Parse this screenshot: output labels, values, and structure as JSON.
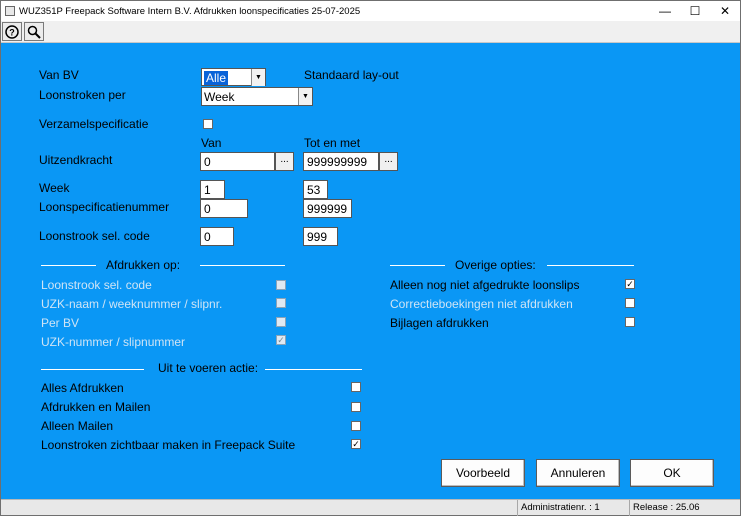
{
  "titlebar": {
    "title": "WUZ351P    Freepack Software Intern B.V.  Afdrukken loonspecificaties  25-07-2025",
    "minimize": "—",
    "maximize": "☐",
    "close": "✕"
  },
  "toolbar": {
    "help_icon": "help-icon",
    "search_icon": "search-icon"
  },
  "form": {
    "van_bv_label": "Van BV",
    "van_bv_value": "Alle",
    "standaard_layout": "Standaard lay-out",
    "loonstroken_per_label": "Loonstroken per",
    "loonstroken_per_value": "Week",
    "verzamelspec_label": "Verzamelspecificatie",
    "van_header": "Van",
    "tot_header": "Tot en met",
    "uitzendkracht_label": "Uitzendkracht",
    "uitzendkracht_van": "0",
    "uitzendkracht_tot": "999999999",
    "dots": "...",
    "week_label": "Week",
    "week_van": "1",
    "week_tot": "53",
    "loonspec_label": "Loonspecificatienummer",
    "loonspec_van": "0",
    "loonspec_tot": "999999",
    "selcode_label": "Loonstrook sel. code",
    "selcode_van": "0",
    "selcode_tot": "999"
  },
  "afdrukken_op": {
    "header": "Afdrukken op:",
    "items": [
      {
        "label": "Loonstrook sel. code",
        "checked": ""
      },
      {
        "label": "UZK-naam / weeknummer / slipnr.",
        "checked": ""
      },
      {
        "label": "Per BV",
        "checked": ""
      },
      {
        "label": "UZK-nummer / slipnummer",
        "checked": "✓"
      }
    ]
  },
  "overige": {
    "header": "Overige opties:",
    "items": [
      {
        "label": "Alleen nog niet afgedrukte loonslips",
        "checked": "✓"
      },
      {
        "label": "Correctieboekingen niet afdrukken",
        "checked": ""
      },
      {
        "label": "Bijlagen afdrukken",
        "checked": ""
      }
    ]
  },
  "actie": {
    "header": "Uit te voeren actie:",
    "items": [
      {
        "label": "Alles Afdrukken",
        "checked": ""
      },
      {
        "label": "Afdrukken en Mailen",
        "checked": ""
      },
      {
        "label": "Alleen Mailen",
        "checked": ""
      },
      {
        "label": "Loonstroken zichtbaar maken in Freepack Suite",
        "checked": "✓"
      }
    ]
  },
  "buttons": {
    "voorbeeld": "Voorbeeld",
    "annuleren": "Annuleren",
    "ok": "OK"
  },
  "statusbar": {
    "admin": "Administratienr. :   1",
    "release": "Release : 25.06"
  }
}
